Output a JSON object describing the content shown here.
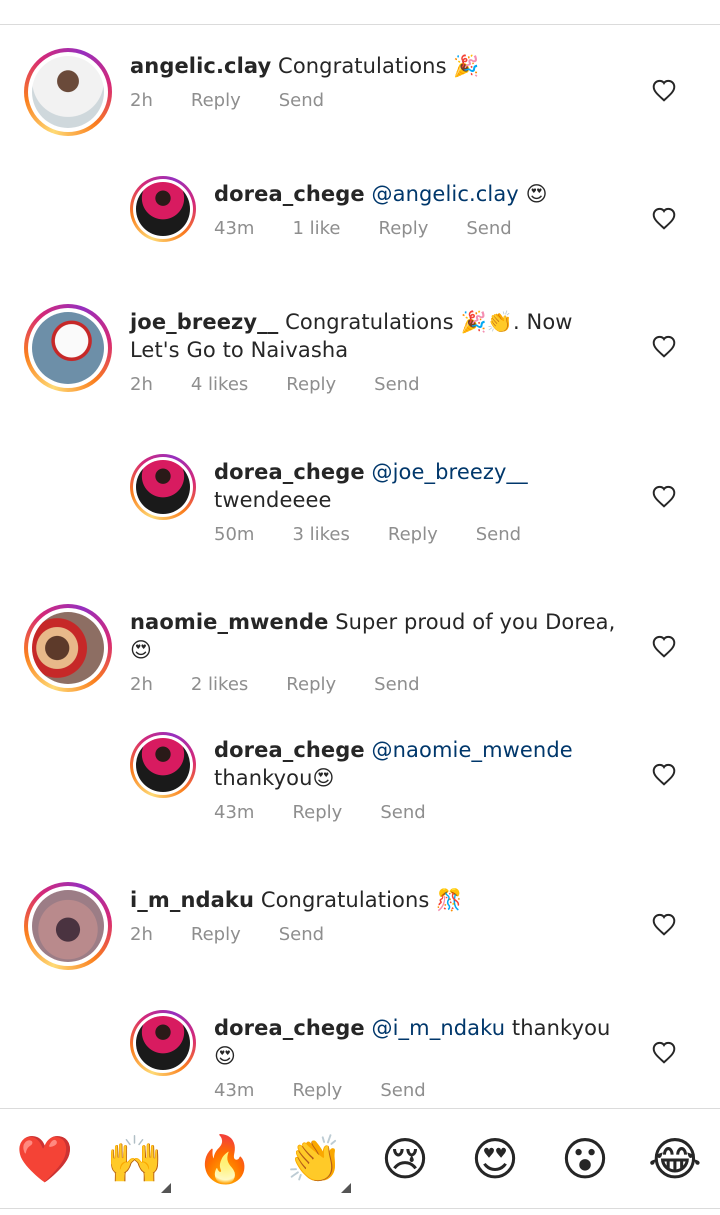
{
  "comments": [
    {
      "username": "angelic.clay",
      "mention": "",
      "text": " Congratulations 🎉",
      "time": "2h",
      "likes": "",
      "reply": "Reply",
      "send": "Send"
    },
    {
      "username": "dorea_chege",
      "mention": " @angelic.clay",
      "text": " 😍",
      "time": "43m",
      "likes": "1 like",
      "reply": "Reply",
      "send": "Send"
    },
    {
      "username": "joe_breezy__",
      "mention": "",
      "text": " Congratulations 🎉👏. Now Let's Go to Naivasha",
      "time": "2h",
      "likes": "4 likes",
      "reply": "Reply",
      "send": "Send"
    },
    {
      "username": "dorea_chege",
      "mention": " @joe_breezy__",
      "text": " twendeeee",
      "time": "50m",
      "likes": "3 likes",
      "reply": "Reply",
      "send": "Send"
    },
    {
      "username": "naomie_mwende",
      "mention": "",
      "text": " Super proud of you Dorea,😍",
      "time": "2h",
      "likes": "2 likes",
      "reply": "Reply",
      "send": "Send"
    },
    {
      "username": "dorea_chege",
      "mention": " @naomie_mwende",
      "text": " thankyou😍",
      "time": "43m",
      "likes": "",
      "reply": "Reply",
      "send": "Send"
    },
    {
      "username": "i_m_ndaku",
      "mention": "",
      "text": " Congratulations 🎊",
      "time": "2h",
      "likes": "",
      "reply": "Reply",
      "send": "Send"
    },
    {
      "username": "dorea_chege",
      "mention": " @i_m_ndaku",
      "text": " thankyou😍",
      "time": "43m",
      "likes": "",
      "reply": "Reply",
      "send": "Send"
    }
  ],
  "reactions": [
    {
      "emoji": "❤️",
      "name": "heart"
    },
    {
      "emoji": "🙌",
      "name": "raised-hands"
    },
    {
      "emoji": "🔥",
      "name": "fire"
    },
    {
      "emoji": "👏",
      "name": "clapping-hands"
    },
    {
      "emoji": "😢",
      "name": "crying-face"
    },
    {
      "emoji": "😍",
      "name": "heart-eyes"
    },
    {
      "emoji": "😮",
      "name": "surprised-face"
    },
    {
      "emoji": "😂",
      "name": "tears-of-joy"
    }
  ],
  "icons": {
    "like": "heart-outline-icon"
  },
  "colors": {
    "mention": "#00376b",
    "meta": "#8e8e8e",
    "text": "#262626"
  }
}
